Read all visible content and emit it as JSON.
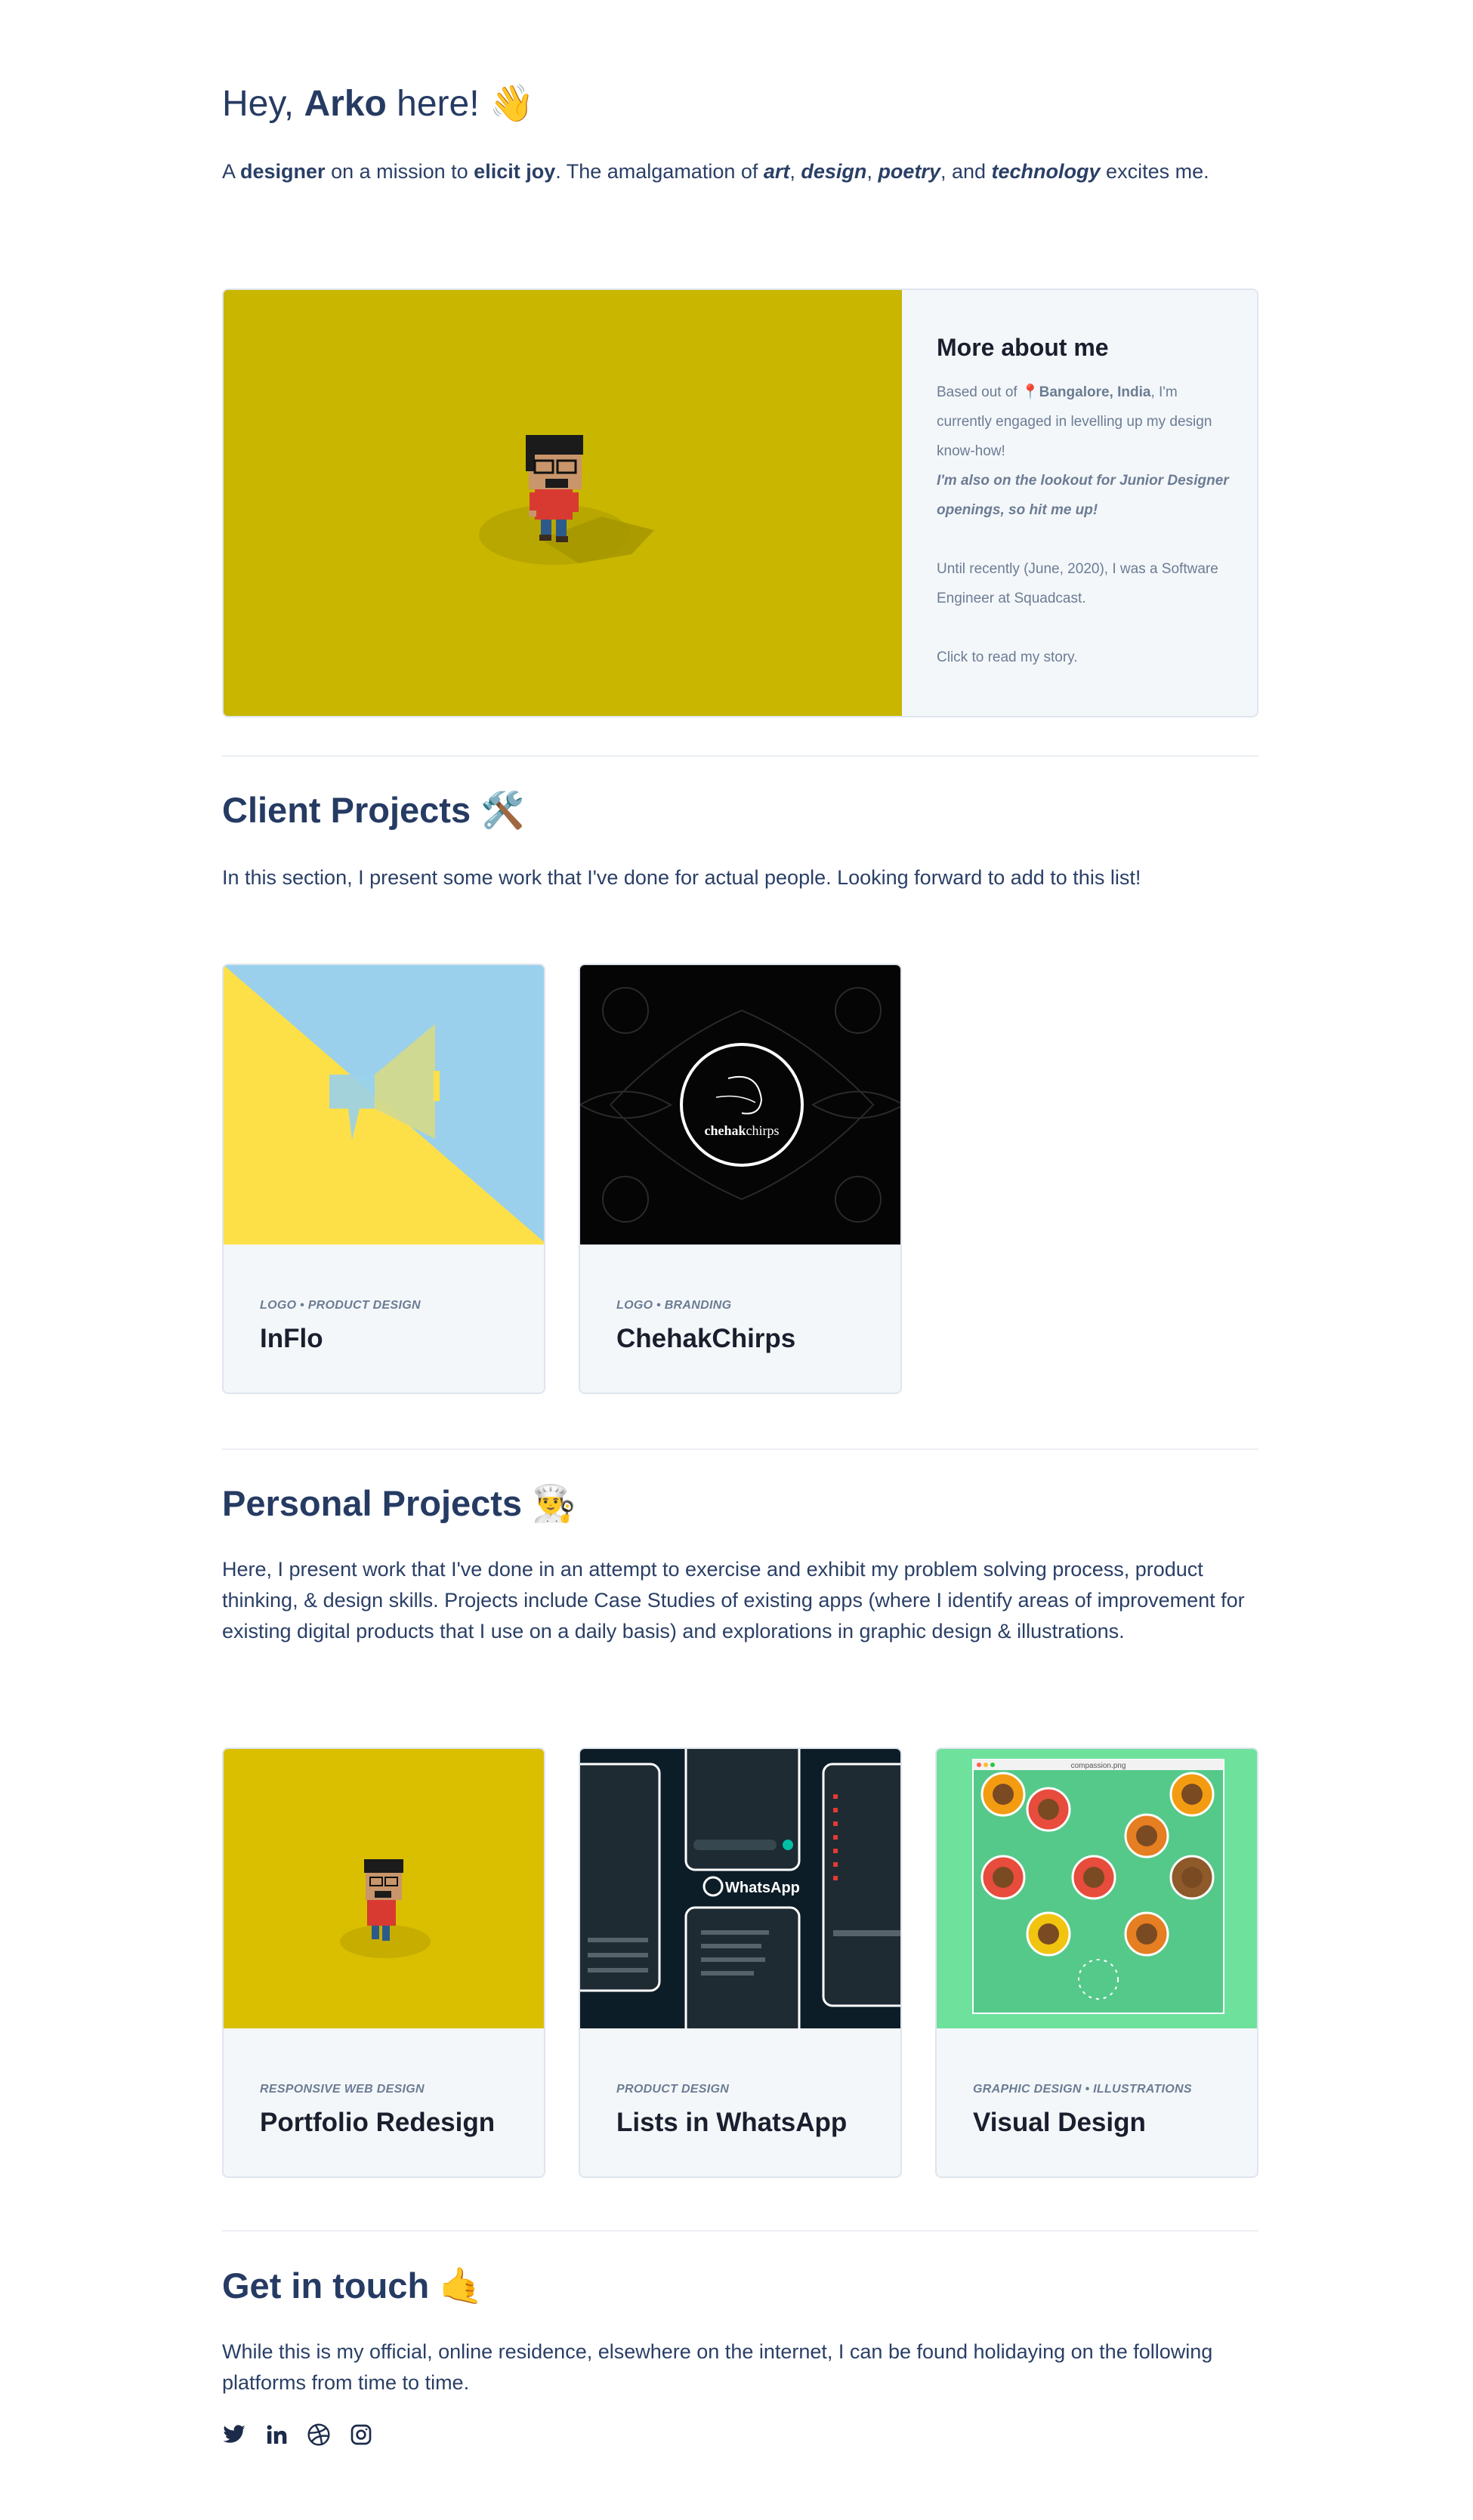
{
  "hero": {
    "title_pre": "Hey, ",
    "title_name": "Arko",
    "title_post": " here! ",
    "title_emoji": "👋",
    "sub_1": "A ",
    "sub_designer": "designer",
    "sub_2": " on a mission to ",
    "sub_joy": "elicit joy",
    "sub_3": ". The amalgamation of ",
    "sub_art": "art",
    "sub_c1": ", ",
    "sub_design": "design",
    "sub_c2": ", ",
    "sub_poetry": "poetry",
    "sub_c3": ", and ",
    "sub_tech": "technology",
    "sub_4": " excites me."
  },
  "about": {
    "heading": "More about me",
    "line1_pre": "Based out of ",
    "pin": "📍",
    "location": "Bangalore, India",
    "line1_post": ", I'm currently engaged in levelling up my design know-how!",
    "lookout": "I'm also on the lookout for Junior Designer openings, so hit me up!",
    "recent": "Until recently (June, 2020), I was a Software Engineer at Squadcast.",
    "cta": "Click to read my story."
  },
  "client": {
    "title": "Client Projects ",
    "emoji": "🛠️",
    "text": "In this section, I present some work that I've done for actual people. Looking forward to add to this list!",
    "cards": [
      {
        "meta": "LOGO • PRODUCT DESIGN",
        "title": "InFlo"
      },
      {
        "meta": "LOGO • BRANDING",
        "title": "ChehakChirps",
        "logo_a": "chehak",
        "logo_b": "chirps"
      }
    ]
  },
  "personal": {
    "title": "Personal Projects ",
    "emoji": "👨‍🍳",
    "text": "Here, I present work that I've done in an attempt to exercise and exhibit my problem solving process, product thinking, & design skills. Projects include Case Studies of existing apps (where I identify areas of improvement for existing digital products that I use on a daily basis) and explorations in graphic design & illustrations.",
    "cards": [
      {
        "meta": "RESPONSIVE WEB DESIGN",
        "title": "Portfolio Redesign"
      },
      {
        "meta": "PRODUCT DESIGN",
        "title": "Lists in WhatsApp",
        "img_label": "WhatsApp"
      },
      {
        "meta": "GRAPHIC DESIGN • ILLUSTRATIONS",
        "title": "Visual Design",
        "img_label": "compassion.png"
      }
    ]
  },
  "contact": {
    "title": "Get in touch ",
    "emoji": "🤙",
    "text": "While this is my official, online residence, elsewhere on the internet, I can be found holidaying on the following platforms from time to time.",
    "icons": [
      "twitter-icon",
      "linkedin-icon",
      "dribbble-icon",
      "instagram-icon"
    ]
  },
  "colors": {
    "heading": "#263b63",
    "text": "#2a3f66",
    "muted": "#6b7c93",
    "about_bg": "#c8b600",
    "card_bg": "#f4f7fa"
  }
}
